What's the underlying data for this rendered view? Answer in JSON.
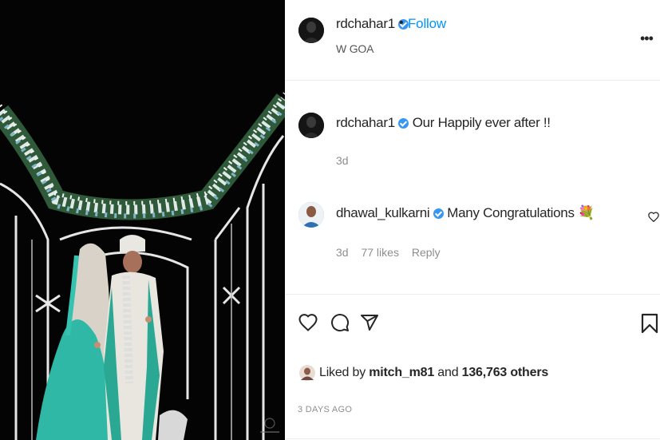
{
  "post": {
    "author": "rdchahar1",
    "follow_label": "Follow",
    "separator": "•",
    "location": "W GOA",
    "more_label": "•••",
    "caption_text": "Our Happily ever after !!",
    "caption_time": "3d",
    "timestamp": "3 DAYS AGO"
  },
  "comment": {
    "username": "dhawal_kulkarni",
    "text": "Many Congratulations",
    "emoji": "💐",
    "time": "3d",
    "likes": "77 likes",
    "reply_label": "Reply"
  },
  "likes": {
    "prefix": "Liked by",
    "user": "mitch_m81",
    "conj": "and",
    "count": "136,763",
    "suffix": "others"
  },
  "icons": {
    "verified": "verified-badge-icon",
    "like": "heart-icon",
    "comment": "comment-icon",
    "share": "share-icon",
    "save": "bookmark-icon",
    "more": "more-options-icon"
  },
  "colors": {
    "link": "#0095f6",
    "verified": "#3897f0",
    "muted": "#8e8e8e",
    "text": "#262626"
  }
}
